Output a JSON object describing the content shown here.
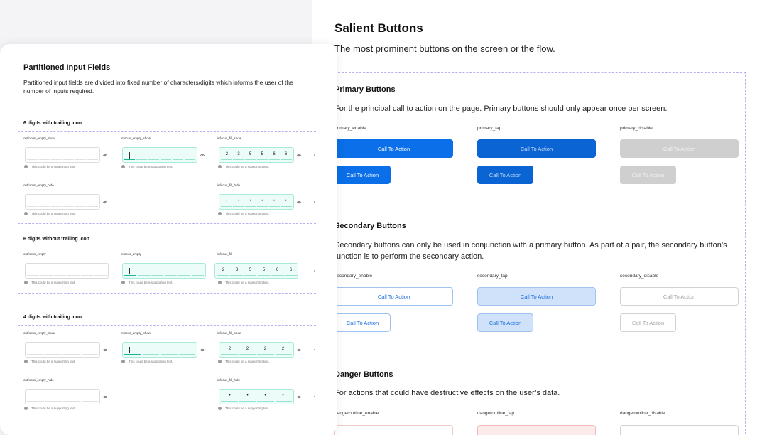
{
  "salient": {
    "title": "Salient Buttons",
    "description": "The most prominent buttons on the screen or the flow.",
    "sections": [
      {
        "id": "primary",
        "title": "Primary Buttons",
        "description": "For the principal call to action on the page. Primary buttons should only appear once per screen.",
        "states": [
          {
            "label": "primary_enable",
            "button_label": "Call To Action",
            "style": "p-enable"
          },
          {
            "label": "primary_tap",
            "button_label": "Call To Action",
            "style": "p-tap"
          },
          {
            "label": "primary_disable",
            "button_label": "Call To Action",
            "style": "p-disable"
          }
        ]
      },
      {
        "id": "secondary",
        "title": "Secondary Buttons",
        "description": "Secondary buttons can only be used in conjunction with a primary button. As part of a pair, the secondary button’s function is to perform the secondary action.",
        "states": [
          {
            "label": "secondary_enable",
            "button_label": "Call To Action",
            "style": "s-enable"
          },
          {
            "label": "secondary_tap",
            "button_label": "Call To Action",
            "style": "s-tap"
          },
          {
            "label": "secondary_disable",
            "button_label": "Call To Action",
            "style": "s-disable"
          }
        ]
      },
      {
        "id": "danger",
        "title": "Danger Buttons",
        "description": "For actions that could have destructive effects on the user’s data.",
        "states": [
          {
            "label": "dangeroutline_enable",
            "button_label": "",
            "style": "d-enable"
          },
          {
            "label": "dangeroutline_tap",
            "button_label": "",
            "style": "d-tap"
          },
          {
            "label": "dangeroutline_disable",
            "button_label": "",
            "style": "d-disable"
          }
        ]
      }
    ],
    "colors": {
      "primary": "#0a6fe8",
      "secondary_tap_bg": "#cfe2fa",
      "disabled": "#cfcfcf",
      "frame_border": "#b9b0ef"
    }
  },
  "partitioned": {
    "title": "Partitioned Input Fields",
    "description": "Partitioned input fields are divided into fixed number of characters/digits which informs the user of the number of inputs required.",
    "supporting_text": "This could be a supporting text.",
    "eye_icon": "eye-icon",
    "sections": [
      {
        "title": "6 digits with trailing icon",
        "fields": [
          {
            "label": "outfocus_empty_show",
            "state": "empty",
            "digits": []
          },
          {
            "label": "infocus_empty_show",
            "state": "focus-empty",
            "digits": []
          },
          {
            "label": "infocus_fill_show",
            "state": "filled",
            "digits": [
              "2",
              "3",
              "5",
              "5",
              "6",
              "6"
            ]
          },
          {
            "label": "outfocus_empty_hide",
            "state": "empty",
            "digits": []
          },
          {
            "label": "infocus_fill_hide",
            "state": "filled",
            "digits": [
              "•",
              "•",
              "•",
              "•",
              "•",
              "•"
            ]
          }
        ]
      },
      {
        "title": "6 digits without trailing icon",
        "fields": [
          {
            "label": "outfocus_empty",
            "state": "empty",
            "digits": []
          },
          {
            "label": "infocus_empty",
            "state": "focus-empty",
            "digits": []
          },
          {
            "label": "infocus_fill",
            "state": "filled",
            "digits": [
              "2",
              "3",
              "5",
              "5",
              "6",
              "6"
            ]
          }
        ]
      },
      {
        "title": "4 digits with trailing icon",
        "fields": [
          {
            "label": "outfocus_empty_show",
            "state": "empty",
            "digits": []
          },
          {
            "label": "infocus_empty_show",
            "state": "focus-empty",
            "digits": []
          },
          {
            "label": "infocus_fill_show",
            "state": "filled",
            "digits": [
              "2",
              "2",
              "2",
              "2"
            ]
          },
          {
            "label": "outfocus_empty_hide",
            "state": "empty",
            "digits": []
          },
          {
            "label": "infocus_fill_hide",
            "state": "filled",
            "digits": [
              "•",
              "•",
              "•",
              "•"
            ]
          }
        ]
      }
    ],
    "colors": {
      "focus_bg": "#ebfcf9",
      "focus_border": "#a9ead9",
      "focus_underline": "#18b993"
    }
  }
}
